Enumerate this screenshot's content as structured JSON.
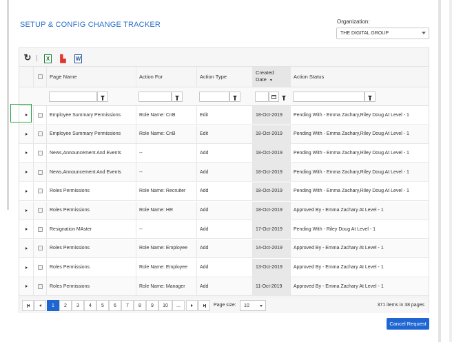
{
  "page": {
    "title": "SETUP & CONFIG CHANGE TRACKER"
  },
  "organization": {
    "label": "Organization:",
    "selected": "THE DIGITAL GROUP"
  },
  "toolbar": {
    "refresh_icon": "refresh-icon",
    "excel_icon": "excel-icon",
    "pdf_icon": "pdf-icon",
    "word_icon": "word-icon",
    "excel_glyph": "X",
    "word_glyph": "W"
  },
  "columns": {
    "page_name": "Page Name",
    "action_for": "Action For",
    "action_type": "Action Type",
    "created_line1": "Created",
    "created_line2": "Date",
    "action_status": "Action Status"
  },
  "rows": [
    {
      "page_name": "Employee Summary Permissions",
      "action_for": "Role Name: CnB",
      "action_type": "Edit",
      "created_date": "18-Oct-2019",
      "action_status": "Pending With - Emma Zachary,Riley Doug At Level - 1"
    },
    {
      "page_name": "Employee Summary Permissions",
      "action_for": "Role Name: CnB",
      "action_type": "Edit",
      "created_date": "18-Oct-2019",
      "action_status": "Pending With - Emma Zachary,Riley Doug At Level - 1"
    },
    {
      "page_name": "News,Announcement And Events",
      "action_for": "--",
      "action_type": "Add",
      "created_date": "18-Oct-2019",
      "action_status": "Pending With - Emma Zachary,Riley Doug At Level - 1"
    },
    {
      "page_name": "News,Announcement And Events",
      "action_for": "--",
      "action_type": "Add",
      "created_date": "18-Oct-2019",
      "action_status": "Pending With - Emma Zachary,Riley Doug At Level - 1"
    },
    {
      "page_name": "Roles Permissions",
      "action_for": "Role Name: Recruiter",
      "action_type": "Add",
      "created_date": "18-Oct-2019",
      "action_status": "Pending With - Emma Zachary,Riley Doug At Level - 1"
    },
    {
      "page_name": "Roles Permissions",
      "action_for": "Role Name: HR",
      "action_type": "Add",
      "created_date": "18-Oct-2019",
      "action_status": "Approved By - Emma Zachary At Level - 1"
    },
    {
      "page_name": "Resignation MAster",
      "action_for": "--",
      "action_type": "Add",
      "created_date": "17-Oct-2019",
      "action_status": "Pending With - Riley Doug At Level - 1"
    },
    {
      "page_name": "Roles Permissions",
      "action_for": "Role Name: Employee",
      "action_type": "Add",
      "created_date": "14-Oct-2019",
      "action_status": "Approved By - Emma Zachary At Level - 1"
    },
    {
      "page_name": "Roles Permissions",
      "action_for": "Role Name: Employee",
      "action_type": "Add",
      "created_date": "13-Oct-2019",
      "action_status": "Approved By - Emma Zachary At Level - 1"
    },
    {
      "page_name": "Roles Permissions",
      "action_for": "Role Name: Manager",
      "action_type": "Add",
      "created_date": "11-Oct-2019",
      "action_status": "Approved By - Emma Zachary At Level - 1"
    }
  ],
  "pager": {
    "pages": [
      "1",
      "2",
      "3",
      "4",
      "5",
      "6",
      "7",
      "8",
      "9",
      "10",
      "..."
    ],
    "active_page": "1",
    "page_size_label": "Page size:",
    "page_size": "10",
    "info": "371 items in 38 pages"
  },
  "actions": {
    "cancel_request": "Cancel Request"
  },
  "colors": {
    "accent": "#1f66d3",
    "title": "#2a6fc9",
    "highlight": "#1aa33f"
  }
}
